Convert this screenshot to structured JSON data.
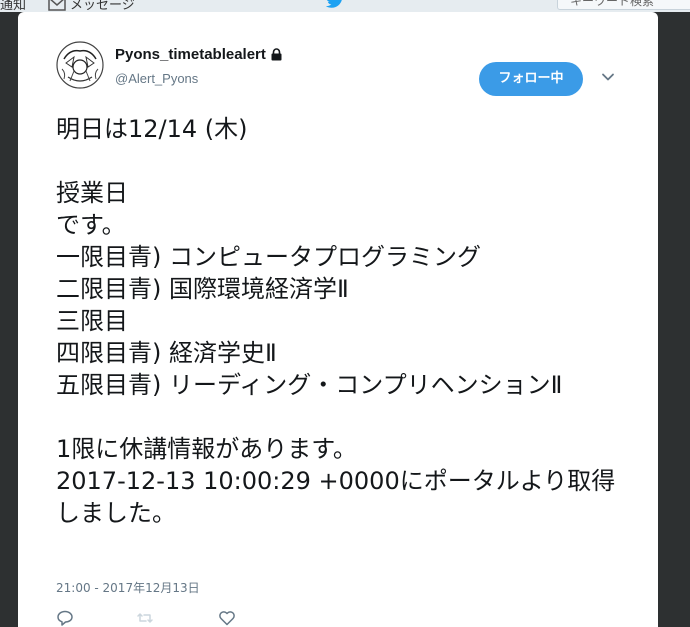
{
  "nav": {
    "notifications_label": "通知",
    "messages_label": "メッセージ",
    "search_placeholder": "キーワード検索"
  },
  "tweet": {
    "user": {
      "name": "Pyons_timetablealert",
      "handle": "@Alert_Pyons",
      "protected": true
    },
    "follow_button_label": "フォロー中",
    "text": "明日は12/14 (木)\n\n授業日\nです。\n一限目青) コンピュータプログラミング\n二限目青) 国際環境経済学Ⅱ\n三限目\n四限目青) 経済学史Ⅱ\n五限目青) リーディング・コンプリヘンションⅡ\n\n1限に休講情報があります。\n2017-12-13 10:00:29 +0000にポータルより取得しました。",
    "timestamp": "21:00 - 2017年12月13日",
    "actions": [
      "reply-icon",
      "retweet-icon",
      "like-icon"
    ]
  },
  "colors": {
    "follow_button_bg": "#3b9be7",
    "handle_gray": "#657786",
    "text_dark": "#14171a",
    "overlay": "#656a6e",
    "twitter_blue": "#1da1f2"
  }
}
